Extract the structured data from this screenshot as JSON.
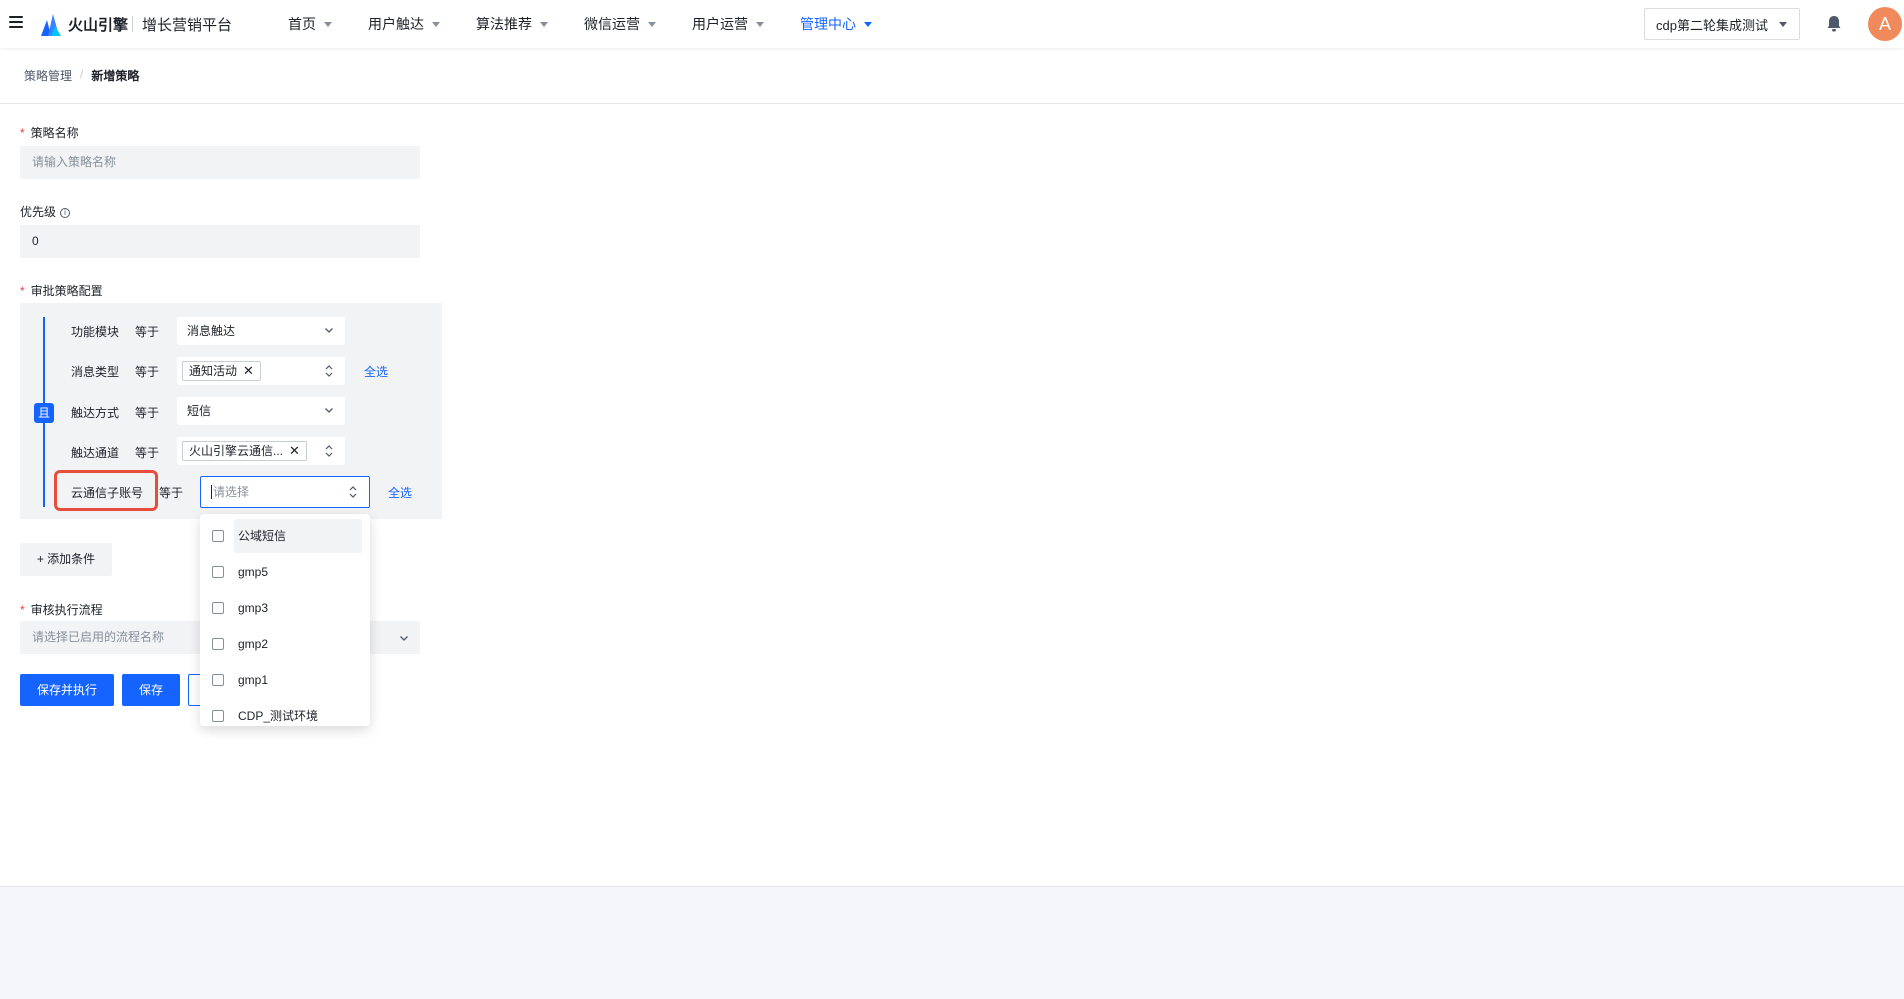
{
  "header": {
    "brand": "火山引擎",
    "platform": "增长营销平台",
    "nav": [
      {
        "label": "首页"
      },
      {
        "label": "用户触达"
      },
      {
        "label": "算法推荐"
      },
      {
        "label": "微信运营"
      },
      {
        "label": "用户运营"
      },
      {
        "label": "管理中心"
      }
    ],
    "active_nav": "管理中心",
    "project": "cdp第二轮集成测试",
    "avatar_initial": "A",
    "accent_color": "#1664ff"
  },
  "breadcrumb": {
    "parent": "策略管理",
    "separator": "/",
    "current": "新增策略"
  },
  "form": {
    "name": {
      "label": "策略名称",
      "placeholder": "请输入策略名称",
      "value": ""
    },
    "priority": {
      "label": "优先级",
      "value": "0",
      "info_icon": "info-circle-icon"
    },
    "approval": {
      "label": "审批策略配置",
      "logic": "且",
      "conditions": [
        {
          "field": "功能模块",
          "op": "等于",
          "value": "消息触达"
        },
        {
          "field": "消息类型",
          "op": "等于",
          "tag": "通知活动",
          "select_all": "全选"
        },
        {
          "field": "触达方式",
          "op": "等于",
          "value": "短信"
        },
        {
          "field": "触达通道",
          "op": "等于",
          "tag": "火山引擎云通信..."
        },
        {
          "field": "云通信子账号",
          "op": "等于",
          "placeholder": "请选择",
          "select_all": "全选"
        }
      ],
      "add_condition": "+ 添加条件"
    },
    "flow": {
      "label": "审核执行流程",
      "placeholder": "请选择已启用的流程名称"
    }
  },
  "dropdown": {
    "options": [
      "公域短信",
      "gmp5",
      "gmp3",
      "gmp2",
      "gmp1",
      "CDP_测试环境"
    ]
  },
  "actions": {
    "save_execute": "保存并执行",
    "save": "保存"
  }
}
